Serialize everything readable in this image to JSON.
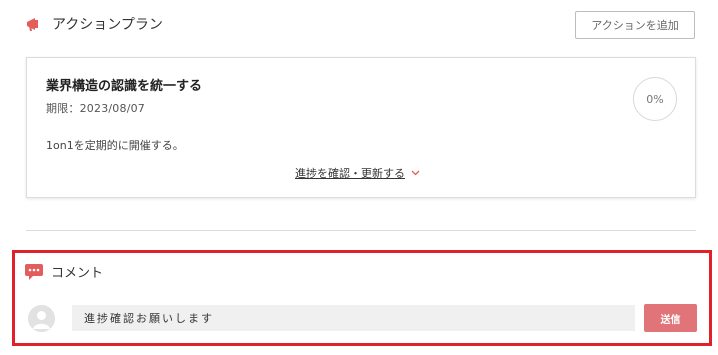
{
  "action_plan": {
    "section_title": "アクションプラン",
    "add_button_label": "アクションを追加",
    "icon": "megaphone-icon",
    "accent_color": "#e35d5d",
    "items": [
      {
        "title": "業界構造の認識を統一する",
        "deadline": "期限：2023/08/07",
        "description": "1on1を定期的に開催する。",
        "progress": "0%",
        "progress_link": "進捗を確認・更新する"
      }
    ]
  },
  "comments": {
    "section_title": "コメント",
    "icon": "comment-icon",
    "input_value": "進捗確認お願いします",
    "send_label": "送信",
    "send_color": "#e07478",
    "highlight_color": "#e0202b"
  }
}
